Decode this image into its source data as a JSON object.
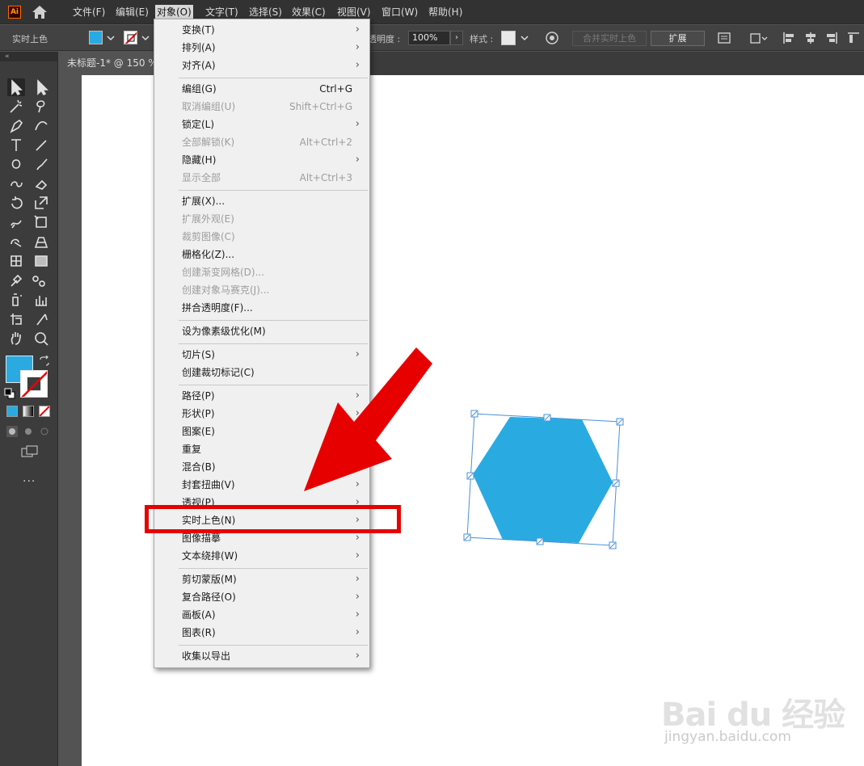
{
  "menubar": {
    "items": [
      "文件(F)",
      "编辑(E)",
      "对象(O)",
      "文字(T)",
      "选择(S)",
      "效果(C)",
      "视图(V)",
      "窗口(W)",
      "帮助(H)"
    ],
    "active_index": 2,
    "app_logo": "Ai"
  },
  "control_bar": {
    "mode_label": "实时上色",
    "opacity_label": "透明度 :",
    "opacity_value": "100%",
    "style_label": "样式 :",
    "merge_button": "合并实时上色",
    "expand_button": "扩展",
    "fill_color": "#29abe2"
  },
  "document": {
    "tab_title": "未标题-1* @ 150 %"
  },
  "toolbar": {
    "fill_color": "#29abe2",
    "stroke_color": "none",
    "more_label": "..."
  },
  "dropdown": {
    "items": [
      {
        "label": "变换(T)",
        "shortcut": "",
        "submenu": true,
        "disabled": false
      },
      {
        "label": "排列(A)",
        "shortcut": "",
        "submenu": true,
        "disabled": false
      },
      {
        "label": "对齐(A)",
        "shortcut": "",
        "submenu": true,
        "disabled": false
      },
      {
        "label": "编组(G)",
        "shortcut": "Ctrl+G",
        "submenu": false,
        "disabled": false
      },
      {
        "label": "取消编组(U)",
        "shortcut": "Shift+Ctrl+G",
        "submenu": false,
        "disabled": true
      },
      {
        "label": "锁定(L)",
        "shortcut": "",
        "submenu": true,
        "disabled": false
      },
      {
        "label": "全部解锁(K)",
        "shortcut": "Alt+Ctrl+2",
        "submenu": false,
        "disabled": true
      },
      {
        "label": "隐藏(H)",
        "shortcut": "",
        "submenu": true,
        "disabled": false
      },
      {
        "label": "显示全部",
        "shortcut": "Alt+Ctrl+3",
        "submenu": false,
        "disabled": true
      },
      {
        "label": "扩展(X)...",
        "shortcut": "",
        "submenu": false,
        "disabled": false
      },
      {
        "label": "扩展外观(E)",
        "shortcut": "",
        "submenu": false,
        "disabled": true
      },
      {
        "label": "裁剪图像(C)",
        "shortcut": "",
        "submenu": false,
        "disabled": true
      },
      {
        "label": "栅格化(Z)...",
        "shortcut": "",
        "submenu": false,
        "disabled": false
      },
      {
        "label": "创建渐变网格(D)...",
        "shortcut": "",
        "submenu": false,
        "disabled": true
      },
      {
        "label": "创建对象马赛克(J)...",
        "shortcut": "",
        "submenu": false,
        "disabled": true
      },
      {
        "label": "拼合透明度(F)...",
        "shortcut": "",
        "submenu": false,
        "disabled": false
      },
      {
        "label": "设为像素级优化(M)",
        "shortcut": "",
        "submenu": false,
        "disabled": false
      },
      {
        "label": "切片(S)",
        "shortcut": "",
        "submenu": true,
        "disabled": false
      },
      {
        "label": "创建裁切标记(C)",
        "shortcut": "",
        "submenu": false,
        "disabled": false
      },
      {
        "label": "路径(P)",
        "shortcut": "",
        "submenu": true,
        "disabled": false
      },
      {
        "label": "形状(P)",
        "shortcut": "",
        "submenu": true,
        "disabled": false
      },
      {
        "label": "图案(E)",
        "shortcut": "",
        "submenu": true,
        "disabled": false
      },
      {
        "label": "重复",
        "shortcut": "",
        "submenu": false,
        "disabled": false
      },
      {
        "label": "混合(B)",
        "shortcut": "",
        "submenu": true,
        "disabled": false
      },
      {
        "label": "封套扭曲(V)",
        "shortcut": "",
        "submenu": true,
        "disabled": false
      },
      {
        "label": "透视(P)",
        "shortcut": "",
        "submenu": true,
        "disabled": false
      },
      {
        "label": "实时上色(N)",
        "shortcut": "",
        "submenu": true,
        "disabled": false
      },
      {
        "label": "图像描摹",
        "shortcut": "",
        "submenu": true,
        "disabled": false
      },
      {
        "label": "文本绕排(W)",
        "shortcut": "",
        "submenu": true,
        "disabled": false
      },
      {
        "label": "剪切蒙版(M)",
        "shortcut": "",
        "submenu": true,
        "disabled": false
      },
      {
        "label": "复合路径(O)",
        "shortcut": "",
        "submenu": true,
        "disabled": false
      },
      {
        "label": "画板(A)",
        "shortcut": "",
        "submenu": true,
        "disabled": false
      },
      {
        "label": "图表(R)",
        "shortcut": "",
        "submenu": true,
        "disabled": false
      },
      {
        "label": "收集以导出",
        "shortcut": "",
        "submenu": true,
        "disabled": false
      }
    ],
    "highlighted_index": 26
  },
  "canvas": {
    "shape_color": "#29abe2",
    "selection_color": "#4a90d9"
  },
  "annotation": {
    "arrow_color": "#e60000",
    "box_color": "#e60000"
  },
  "watermark": {
    "logo": "Bai du 经验",
    "url": "jingyan.baidu.com"
  }
}
